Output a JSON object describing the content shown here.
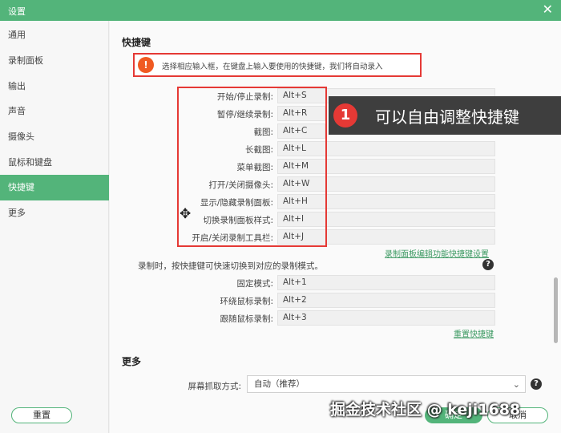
{
  "window": {
    "title": "设置",
    "close_icon": "close-icon"
  },
  "sidebar": {
    "items": [
      {
        "label": "通用"
      },
      {
        "label": "录制面板"
      },
      {
        "label": "输出"
      },
      {
        "label": "声音"
      },
      {
        "label": "摄像头"
      },
      {
        "label": "鼠标和键盘"
      },
      {
        "label": "快捷键",
        "active": true
      },
      {
        "label": "更多"
      }
    ],
    "reset_all_label": "重置"
  },
  "hotkeys": {
    "section_title": "快捷键",
    "notice": "选择相应输入框，在键盘上输入要使用的快捷键，我们将自动录入",
    "items": [
      {
        "label": "开始/停止录制:",
        "value": "Alt+S"
      },
      {
        "label": "暂停/继续录制:",
        "value": "Alt+R"
      },
      {
        "label": "截图:",
        "value": "Alt+C"
      },
      {
        "label": "长截图:",
        "value": "Alt+L"
      },
      {
        "label": "菜单截图:",
        "value": "Alt+M"
      },
      {
        "label": "打开/关闭摄像头:",
        "value": "Alt+W"
      },
      {
        "label": "显示/隐藏录制面板:",
        "value": "Alt+H"
      },
      {
        "label": "切换录制面板样式:",
        "value": "Alt+I"
      },
      {
        "label": "开启/关闭录制工具栏:",
        "value": "Alt+J"
      }
    ],
    "panel_link": "录制面板编辑功能快捷键设置",
    "mode_hint": "录制时，按快捷键可快速切换到对应的录制模式。",
    "modes": [
      {
        "label": "固定模式:",
        "value": "Alt+1"
      },
      {
        "label": "环绕鼠标录制:",
        "value": "Alt+2"
      },
      {
        "label": "跟随鼠标录制:",
        "value": "Alt+3"
      }
    ],
    "reset_link": "重置快捷键"
  },
  "more": {
    "section_title": "更多",
    "capture_label": "屏幕抓取方式:",
    "capture_value": "自动（推荐）"
  },
  "annotation": {
    "number": "1",
    "text": "可以自由调整快捷键"
  },
  "footer": {
    "ok_label": "确定",
    "cancel_label": "取消"
  },
  "watermark": "掘金技术社区 @ keji1688",
  "colors": {
    "accent": "#53b47a",
    "highlight_red": "#e53935",
    "callout_bg": "#3e3e3e"
  }
}
